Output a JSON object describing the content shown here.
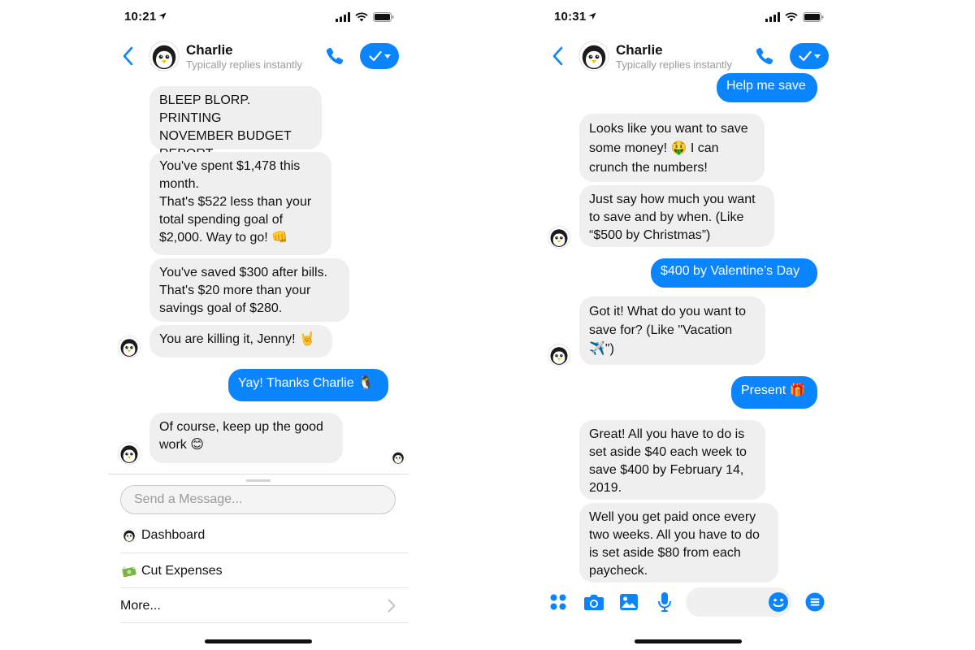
{
  "colors": {
    "accent": "#0a84ff",
    "incoming_bubble": "#efefef",
    "muted": "#9a9a9a"
  },
  "icons": [
    "location-arrow-icon",
    "signal-icon",
    "wifi-icon",
    "battery-icon",
    "back-icon",
    "penguin-avatar-icon",
    "phone-icon",
    "checkmark-icon",
    "chevron-right-icon",
    "apps-icon",
    "camera-icon",
    "photo-icon",
    "microphone-icon",
    "emoji-icon",
    "menu-icon"
  ],
  "left": {
    "status": {
      "time": "10:21"
    },
    "header": {
      "name": "Charlie",
      "subtitle": "Typically replies instantly"
    },
    "messages": [
      "BLEEP BLORP. PRINTING\nNOVEMBER BUDGET\nREPORT.",
      "You've spent $1,478 this\nmonth.\nThat's $522 less than your\ntotal spending goal of\n$2,000. Way to go! 👊",
      "You've saved $300 after bills.\nThat's $20 more than your\nsavings goal of $280.",
      "You are killing it, Jenny! 🤘",
      "Yay! Thanks Charlie 🐧",
      "Of course, keep up the good\nwork 😊"
    ],
    "composer": {
      "placeholder": "Send a Message..."
    },
    "quick_replies": [
      "Dashboard",
      "Cut Expenses",
      "More..."
    ]
  },
  "right": {
    "status": {
      "time": "10:31"
    },
    "header": {
      "name": "Charlie",
      "subtitle": "Typically replies instantly"
    },
    "messages": [
      "Help me save",
      "Looks like you want to save\nsome money! 🤑 I can\ncrunch the numbers!",
      "Just say how much you want\nto save and by when. (Like\n“$500 by Christmas”)",
      "$400 by Valentine’s Day",
      "Got it! What do you want to\nsave for? (Like \"Vacation\n✈️\")",
      "Present 🎁",
      "Great! All you have to do is\nset aside $40 each week to\nsave $400 by February 14,\n2019.",
      "Well you get paid once every\ntwo weeks. All you have to do\nis set aside $80 from each\npaycheck."
    ]
  }
}
